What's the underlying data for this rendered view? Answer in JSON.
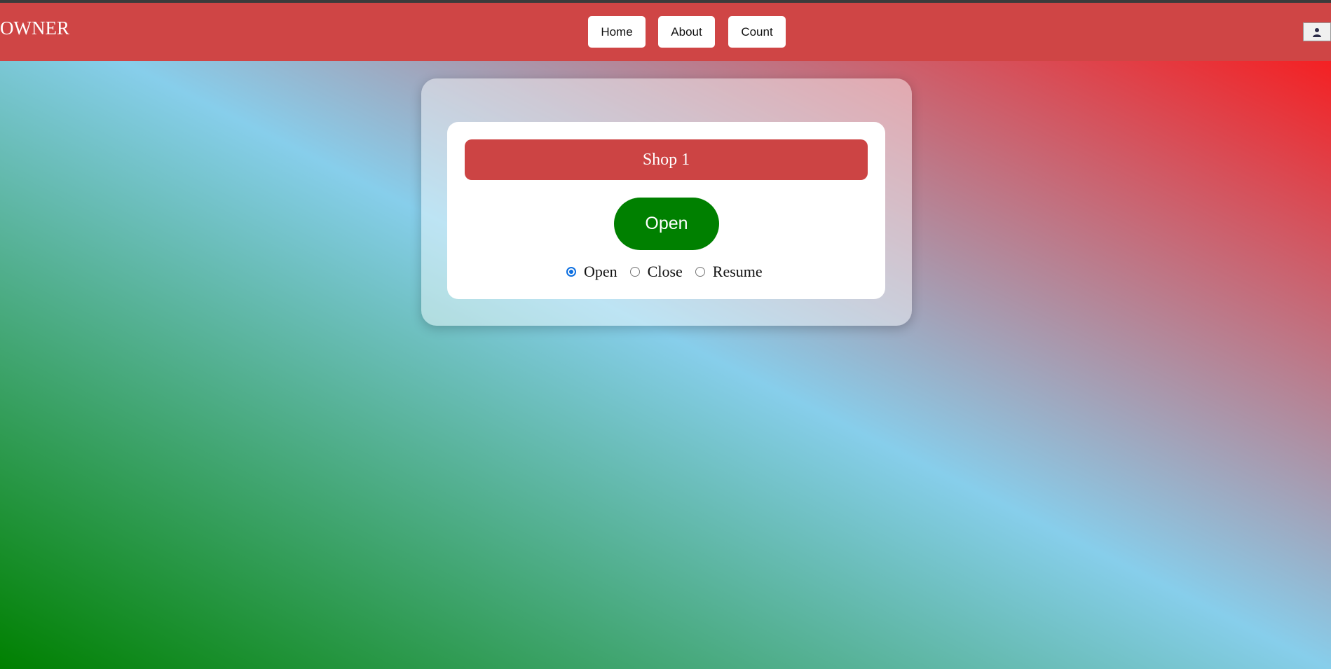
{
  "header": {
    "brand": "OWNER",
    "nav": [
      {
        "label": "Home"
      },
      {
        "label": "About"
      },
      {
        "label": "Count"
      }
    ],
    "user_icon": "user-icon"
  },
  "shop": {
    "name": "Shop 1",
    "status_button": "Open",
    "status_button_color": "#008000",
    "options": [
      {
        "label": "Open",
        "checked": true
      },
      {
        "label": "Close",
        "checked": false
      },
      {
        "label": "Resume",
        "checked": false
      }
    ]
  },
  "colors": {
    "navbar": "#cf4545",
    "title_bar": "#cc4444",
    "gradient": [
      "#008000",
      "#87ceeb",
      "#ff0f0f"
    ]
  }
}
